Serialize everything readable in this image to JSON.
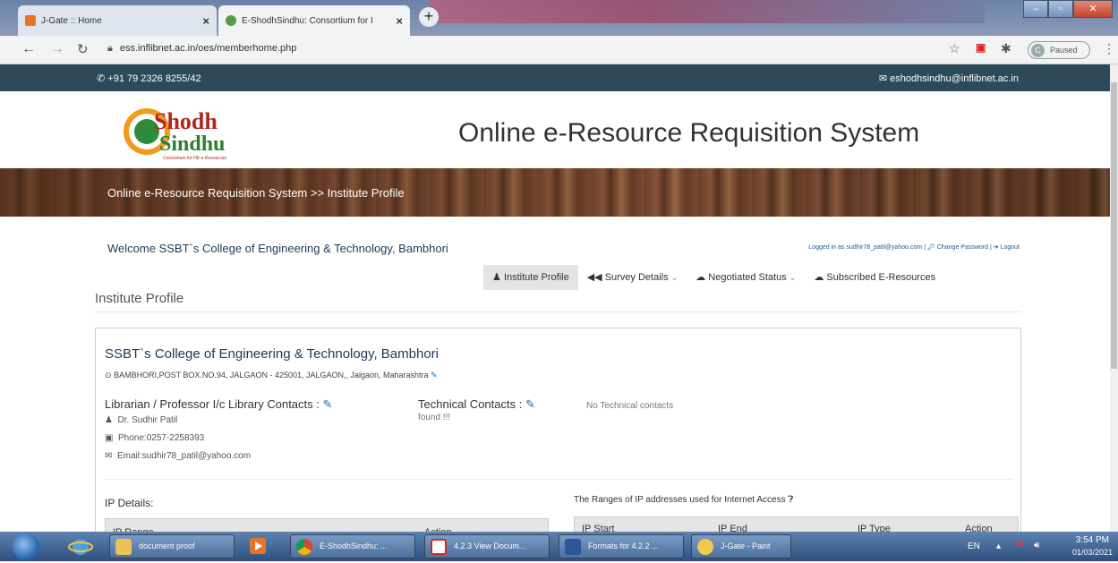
{
  "browser": {
    "tabs": [
      {
        "title": "J-Gate :: Home",
        "close": "×"
      },
      {
        "title": "E-ShodhSindhu: Consortium for I",
        "close": "×"
      }
    ],
    "new_tab": "+",
    "url": "ess.inflibnet.ac.in/oes/memberhome.php",
    "profile_status": "Paused",
    "profile_initial": "C"
  },
  "topstrip": {
    "phone": "+91 79 2326 8255/42",
    "email": "eshodhsindhu@inflibnet.ac.in"
  },
  "header": {
    "title": "Online e-Resource Requisition System",
    "logo_text": {
      "line1": "Shodh",
      "line2": "Sindhu",
      "tagline": "Consortium for HE e-Resources"
    }
  },
  "breadcrumb": "Online e-Resource Requisition System >> Institute Profile",
  "welcome": "Welcome SSBT`s College of Engineering & Technology, Bambhori",
  "account": {
    "logged_in": "Logged in as sudhir78_patil@yahoo.com |",
    "change_password": "Change Password",
    "logout": "Logout"
  },
  "menu": [
    {
      "label": "Institute Profile",
      "icon": "institution-icon"
    },
    {
      "label": "Survey Details",
      "icon": "survey-icon"
    },
    {
      "label": "Negotiated Status",
      "icon": "negotiated-icon"
    },
    {
      "label": "Subscribed E-Resources",
      "icon": "subscribed-icon"
    }
  ],
  "page_title": "Institute Profile",
  "institute": {
    "name": "SSBT`s College of Engineering & Technology, Bambhori",
    "address": "BAMBHORI,POST BOX.NO.94, JALGAON - 425001, JALGAON,, Jalgaon, Maharashtra"
  },
  "library_contacts": {
    "heading": "Librarian / Professor I/c Library Contacts :",
    "name": "Dr. Sudhir Patil",
    "phone": "Phone:0257-2258393",
    "email": "Email:sudhir78_patil@yahoo.com"
  },
  "technical_contacts": {
    "heading": "Technical Contacts :",
    "none": "No Technical contacts found !!!"
  },
  "ip_details": {
    "heading": "IP Details:",
    "columns": [
      "IP Range",
      "Action"
    ]
  },
  "ip_ranges": {
    "heading": "The Ranges of IP addresses used for Internet Access",
    "columns": [
      "IP Start",
      "IP End",
      "IP Type",
      "Action"
    ]
  },
  "taskbar": {
    "tasks": [
      "document proof",
      "E-ShodhSindhu: ...",
      "4.2.3 View Docum...",
      "Formats for 4.2.2 ...",
      "J-Gate - Paint"
    ],
    "lang": "EN",
    "time": "3:54 PM",
    "date": "01/03/2021"
  }
}
